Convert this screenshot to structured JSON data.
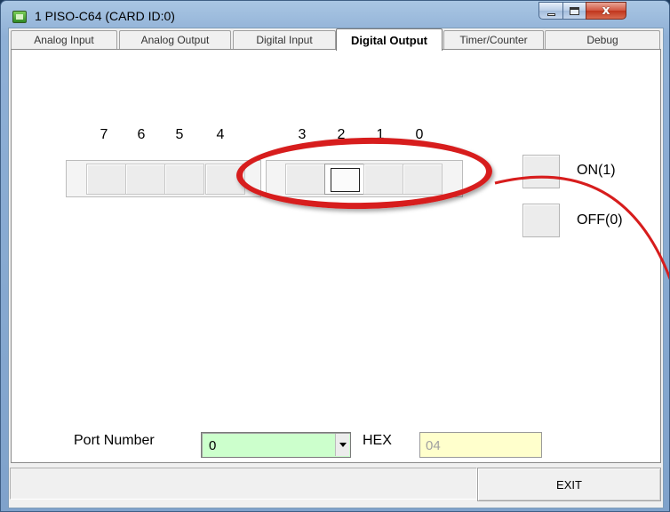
{
  "window": {
    "title": "1 PISO-C64 (CARD ID:0)",
    "close_glyph": "x",
    "accent": "#d71d1d"
  },
  "tabs": [
    {
      "label": "Analog Input",
      "active": false
    },
    {
      "label": "Analog Output",
      "active": false
    },
    {
      "label": "Digital Input",
      "active": false
    },
    {
      "label": "Digital Output",
      "active": true
    },
    {
      "label": "Timer/Counter",
      "active": false
    },
    {
      "label": "Debug",
      "active": false
    }
  ],
  "bits": {
    "labels": [
      "7",
      "6",
      "5",
      "4",
      "3",
      "2",
      "1",
      "0"
    ],
    "states": [
      0,
      0,
      0,
      0,
      0,
      1,
      0,
      0
    ]
  },
  "legend": {
    "on_label": "ON(1)",
    "off_label": "OFF(0)"
  },
  "port": {
    "label": "Port Number",
    "value": "0"
  },
  "hex": {
    "label": "HEX",
    "value": "04"
  },
  "footer": {
    "exit_label": "EXIT"
  },
  "colors": {
    "port_field": "#ccffcc",
    "hex_field": "#ffffcc",
    "highlight_ring": "#d71d1d"
  }
}
